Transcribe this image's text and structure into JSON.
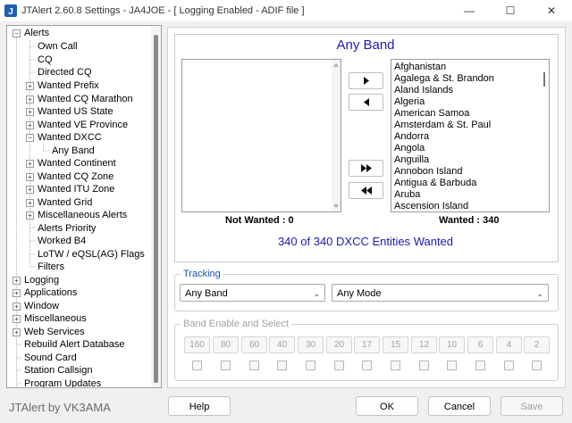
{
  "window": {
    "title": "JTAlert 2.60.8 Settings  -  JA4JOE  -  [ Logging Enabled - ADIF file ]",
    "minimize": "—",
    "maximize": "☐",
    "close": "✕"
  },
  "tree": {
    "items": [
      {
        "label": "Alerts",
        "toggle": "−"
      },
      {
        "label": "Own Call"
      },
      {
        "label": "CQ"
      },
      {
        "label": "Directed CQ"
      },
      {
        "label": "Wanted Prefix",
        "toggle": "+"
      },
      {
        "label": "Wanted CQ Marathon",
        "toggle": "+"
      },
      {
        "label": "Wanted US State",
        "toggle": "+"
      },
      {
        "label": "Wanted VE Province",
        "toggle": "+"
      },
      {
        "label": "Wanted DXCC",
        "toggle": "−"
      },
      {
        "label": "Any Band"
      },
      {
        "label": "Wanted Continent",
        "toggle": "+"
      },
      {
        "label": "Wanted CQ Zone",
        "toggle": "+"
      },
      {
        "label": "Wanted ITU Zone",
        "toggle": "+"
      },
      {
        "label": "Wanted Grid",
        "toggle": "+"
      },
      {
        "label": "Miscellaneous Alerts",
        "toggle": "+"
      },
      {
        "label": "Alerts Priority"
      },
      {
        "label": "Worked B4"
      },
      {
        "label": "LoTW / eQSL(AG) Flags"
      },
      {
        "label": "Filters"
      },
      {
        "label": "Logging",
        "toggle": "+"
      },
      {
        "label": "Applications",
        "toggle": "+"
      },
      {
        "label": "Window",
        "toggle": "+"
      },
      {
        "label": "Miscellaneous",
        "toggle": "+"
      },
      {
        "label": "Web Services",
        "toggle": "+"
      },
      {
        "label": "Rebuild Alert Database"
      },
      {
        "label": "Sound Card"
      },
      {
        "label": "Station Callsign"
      },
      {
        "label": "Program Updates"
      }
    ]
  },
  "main": {
    "title": "Any Band",
    "not_wanted_caption": "Not Wanted : 0",
    "wanted_caption": "Wanted : 340",
    "summary": "340 of 340 DXCC Entities Wanted",
    "wanted_list": [
      "Afghanistan",
      "Agalega & St. Brandon",
      "Aland Islands",
      "Algeria",
      "American Samoa",
      "Amsterdam & St. Paul",
      "Andorra",
      "Angola",
      "Anguilla",
      "Annobon Island",
      "Antigua & Barbuda",
      "Aruba",
      "Ascension Island"
    ],
    "not_wanted_list": []
  },
  "tracking": {
    "label": "Tracking",
    "band_value": "Any Band",
    "mode_value": "Any Mode"
  },
  "band_select": {
    "label": "Band Enable and Select",
    "bands": [
      "160",
      "80",
      "60",
      "40",
      "30",
      "20",
      "17",
      "15",
      "12",
      "10",
      "6",
      "4",
      "2"
    ]
  },
  "footer": {
    "brand": "JTAlert by VK3AMA",
    "help": "Help",
    "ok": "OK",
    "cancel": "Cancel",
    "save": "Save"
  }
}
